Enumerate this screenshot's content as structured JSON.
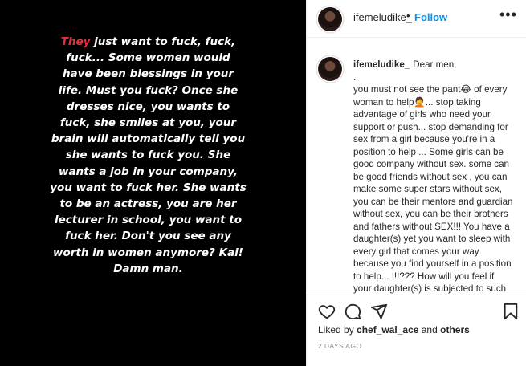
{
  "media": {
    "first_word": "They",
    "text": " just want to fuck, fuck, fuck... Some women would have been blessings in your life. Must you fuck? Once she dresses nice, you wants to fuck, she smiles at you, your brain will automatically tell you she wants to fuck you. She wants a job in your company, you want to fuck her. She wants to be an actress, you are her lecturer in school, you want to fuck her. Don't you see any worth in women anymore? Kai! Damn man."
  },
  "header": {
    "username": "ifemeludike_",
    "separator": "•",
    "follow_label": "Follow",
    "more_label": "•••"
  },
  "caption": {
    "username": "ifemeludike_",
    "line1": "Dear men,",
    "line2": ".",
    "body": "you must not see the pant😂 of every woman to help🤦... stop taking advantage of girls who need your support or push... stop demanding for sex from a girl because you're in a position to help ... Some girls can be good company without sex. some can be good friends without sex , you can make some super stars without sex, you can be their mentors and guardian without sex, you can be their brothers and fathers without SEX!!! You have a daughter(s) yet you want to sleep with every girl that comes your way because you find yourself in a position to help... !!!??? How will you feel if your daughter(s) is subjected to such treatment as yours??? Please"
  },
  "actions": {
    "icons": [
      "heart-icon",
      "comment-icon",
      "share-icon",
      "bookmark-icon"
    ]
  },
  "likes": {
    "prefix": "Liked by ",
    "user": "chef_wal_ace",
    "joiner": " and ",
    "others": "others"
  },
  "time": "2 DAYS AGO",
  "colors": {
    "accent_red": "#e0313c",
    "follow_blue": "#0095f6",
    "text": "#262626",
    "muted": "#8e8e8e"
  }
}
